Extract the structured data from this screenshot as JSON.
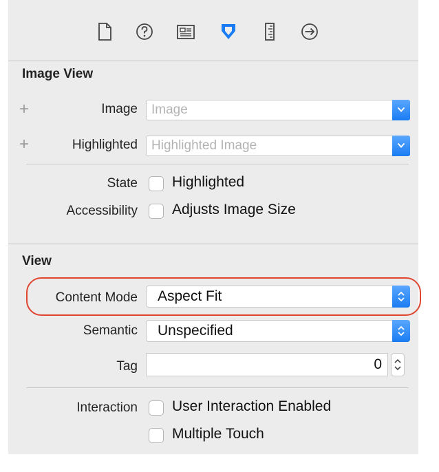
{
  "toolbar": {
    "icons": [
      "file-icon",
      "help-icon",
      "identity-icon",
      "attributes-icon",
      "size-ruler-icon",
      "connections-icon"
    ],
    "accent_color": "#1a7cf2"
  },
  "image_view": {
    "title": "Image View",
    "image": {
      "label": "Image",
      "placeholder": "Image"
    },
    "highlighted": {
      "label": "Highlighted",
      "placeholder": "Highlighted Image"
    },
    "state": {
      "label": "State",
      "option": "Highlighted"
    },
    "accessibility": {
      "label": "Accessibility",
      "option": "Adjusts Image Size"
    }
  },
  "view": {
    "title": "View",
    "content_mode": {
      "label": "Content Mode",
      "value": "Aspect Fit"
    },
    "semantic": {
      "label": "Semantic",
      "value": "Unspecified"
    },
    "tag": {
      "label": "Tag",
      "value": "0"
    },
    "interaction": {
      "label": "Interaction",
      "options": [
        "User Interaction Enabled",
        "Multiple Touch"
      ]
    }
  },
  "annotation_color": "#e0452f"
}
